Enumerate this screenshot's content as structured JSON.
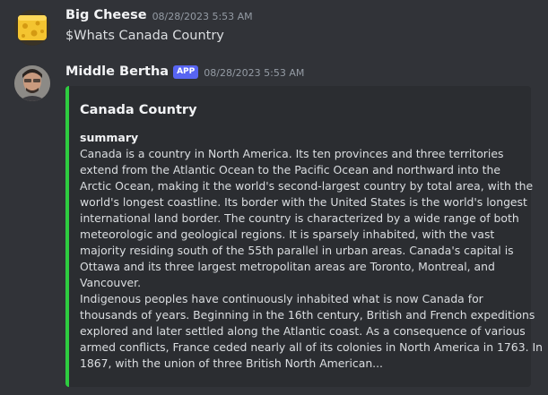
{
  "messages": [
    {
      "username": "Big Cheese",
      "timestamp": "08/28/2023 5:53 AM",
      "text": "$Whats Canada Country"
    },
    {
      "username": "Middle Bertha",
      "badge": "APP",
      "timestamp": "08/28/2023 5:53 AM",
      "embed": {
        "accent_color": "#2ecc40",
        "title": "Canada Country",
        "field_name": "summary",
        "lines": [
          "Canada is a country in North America. Its ten provinces and three territories",
          "extend from the Atlantic Ocean to the Pacific Ocean and northward into the",
          "Arctic Ocean, making it the world's second-largest country by total area, with the",
          "world's longest coastline. Its border with the United States is the world's longest",
          "international land border. The country is characterized by a wide range of both",
          "meteorologic and geological regions. It is sparsely inhabited, with the vast",
          "majority residing south of the 55th parallel in urban areas. Canada's capital is",
          "Ottawa and its three largest metropolitan areas are Toronto, Montreal, and",
          "Vancouver.",
          "Indigenous peoples have continuously inhabited what is now Canada for",
          "thousands of years. Beginning in the 16th century, British and French expeditions",
          "explored and later settled along the Atlantic coast. As a consequence of various",
          "armed conflicts, France ceded nearly all of its colonies in North America in 1763. In",
          "1867, with the union of three British North American..."
        ]
      }
    }
  ]
}
